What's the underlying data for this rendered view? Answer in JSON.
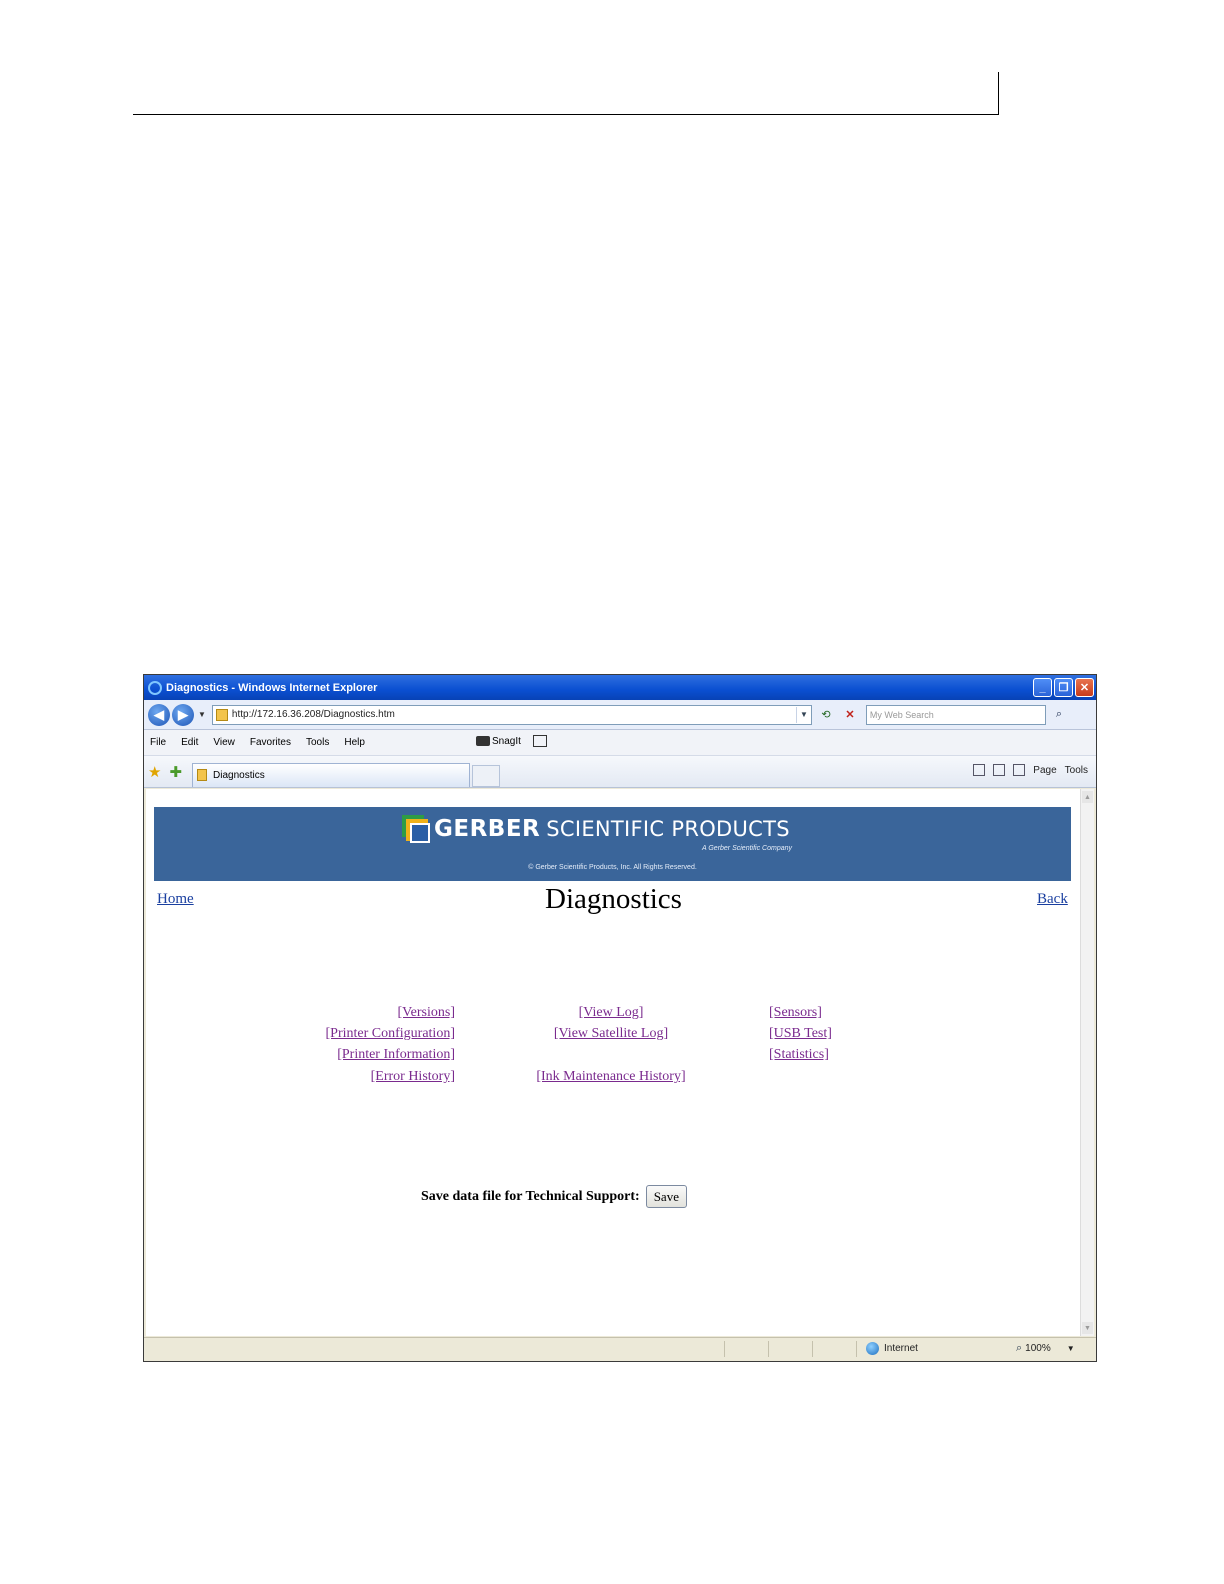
{
  "window": {
    "title": "Diagnostics - Windows Internet Explorer",
    "minimize_glyph": "_",
    "maximize_glyph": "❐",
    "close_glyph": "✕"
  },
  "address_bar": {
    "back_glyph": "◀",
    "forward_glyph": "▶",
    "url": "http://172.16.36.208/Diagnostics.htm",
    "search_placeholder": "My Web Search"
  },
  "menu": [
    "File",
    "Edit",
    "View",
    "Favorites",
    "Tools",
    "Help"
  ],
  "toolbar": {
    "snagit_label": "SnagIt"
  },
  "tab": {
    "label": "Diagnostics"
  },
  "command_bar": {
    "page_label": "Page",
    "tools_label": "Tools"
  },
  "banner": {
    "brand_bold": "GERBER",
    "brand_light": "SCIENTIFIC PRODUCTS",
    "tagline": "A Gerber Scientific Company",
    "copyright": "© Gerber Scientific Products, Inc. All Rights Reserved."
  },
  "nav": {
    "home": "Home",
    "back": "Back"
  },
  "page": {
    "title": "Diagnostics"
  },
  "links": {
    "col1": [
      "[Versions]",
      "[Printer Configuration]",
      "[Printer Information]",
      "[Error History]"
    ],
    "col2": [
      "[View Log]",
      "[View Satellite Log]",
      "[Ink Maintenance History]"
    ],
    "col3": [
      "[Sensors]",
      "[USB Test]",
      "[Statistics]"
    ]
  },
  "save": {
    "label": "Save data file for Technical Support:",
    "button": "Save"
  },
  "status_bar": {
    "zone": "Internet",
    "zoom": "100%"
  }
}
